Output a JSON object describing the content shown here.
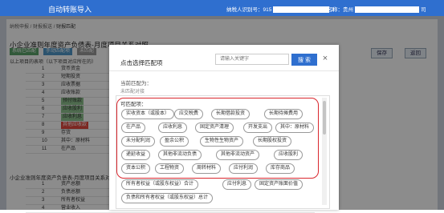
{
  "topbar": {
    "title": "自动转账导入",
    "taxno_label": "纳税人识别号：915",
    "taxno_tail": "3",
    "taxname_label": "纳税人名称：贵州",
    "taxname_tail": "司"
  },
  "page": {
    "breadcrumb_a": "纳税申报",
    "breadcrumb_b": "财报报送",
    "breadcrumb_cur": "财报匹配",
    "section_title": "小企业准则年度资产负债表-月度项目关系对照",
    "tag_a": "系统已匹配",
    "tag_b": "手动匹配项",
    "tag_c": "未匹配",
    "sub_note": "以上项目的表项（以下项目对应所在的）",
    "btn_a": "保存",
    "btn_b": "返回",
    "rows": [
      {
        "idx": "1",
        "name": "货币资金"
      },
      {
        "idx": "2",
        "name": "短期投资"
      },
      {
        "idx": "3",
        "name": "应收票据"
      },
      {
        "idx": "4",
        "name": "应收账款"
      },
      {
        "idx": "5",
        "name": "预付账款"
      },
      {
        "idx": "6",
        "name": "应收股利"
      },
      {
        "idx": "7",
        "name": "应收利息"
      },
      {
        "idx": "8",
        "name": "其他应收款"
      },
      {
        "idx": "9",
        "name": "存货"
      },
      {
        "idx": "10",
        "name": "其中：原材料"
      },
      {
        "idx": "11",
        "name": "在产品"
      }
    ],
    "section2": "小企业准则年度资产负债表-月度项目关系对照",
    "rows2": [
      {
        "idx": "1",
        "name": "资产总额"
      },
      {
        "idx": "2",
        "name": "负债总额"
      },
      {
        "idx": "3",
        "name": "所有者权益"
      },
      {
        "idx": "4",
        "name": "营业收入"
      }
    ]
  },
  "dialog": {
    "title": "点击选择匹配项",
    "search_placeholder": "请输入关键字",
    "search_button": "搜 索",
    "close_glyph": "×",
    "current_label": "当前匹配为：",
    "current_value": "未匹配对接",
    "options_label": "可匹配项：",
    "chips": [
      {
        "label": "实收资本（或股本）"
      },
      {
        "label": "应交税费"
      },
      {
        "label": "长期借款投资"
      },
      {
        "label": "长期待摊费用"
      },
      {
        "label": "在产品"
      },
      {
        "label": "应收利息"
      },
      {
        "label": "固定资产清理"
      },
      {
        "label": "开发支出"
      },
      {
        "label": "其中：原材料"
      },
      {
        "label": "未分配利润"
      },
      {
        "label": "盈余公积"
      },
      {
        "label": "生物性生物资产"
      },
      {
        "label": "长期股权投资"
      },
      {
        "label": "递延收益"
      },
      {
        "label": "其他非流动负债"
      },
      {
        "label": "其他非流动资产"
      },
      {
        "label": "应收股利"
      },
      {
        "label": "资本公积"
      },
      {
        "label": "工程物资"
      },
      {
        "label": "周转材料"
      },
      {
        "label": "应付利润"
      },
      {
        "label": "库存商品"
      },
      {
        "label": "所有者权益（或股东权益）合计"
      },
      {
        "label": "应付利息"
      },
      {
        "label": "固定资产账面价值"
      },
      {
        "label": "负债和所有者权益（或股东权益）总计"
      }
    ]
  },
  "colors": {
    "accent": "#2f6fcf",
    "highlight": "#d9272e"
  }
}
